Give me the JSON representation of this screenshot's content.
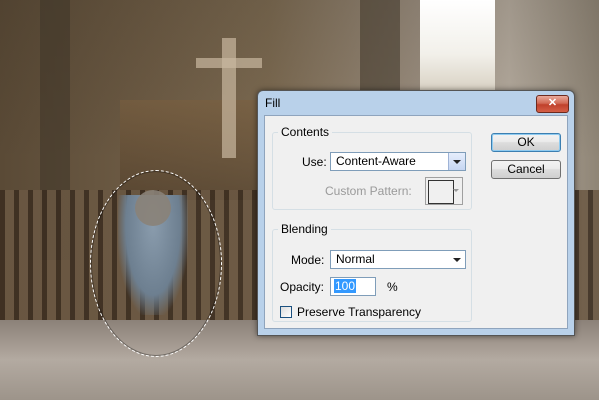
{
  "dialog": {
    "title": "Fill",
    "close_glyph": "✕",
    "contents": {
      "legend": "Contents",
      "use_label": "Use:",
      "use_value": "Content-Aware",
      "custom_pattern_label": "Custom Pattern:"
    },
    "blending": {
      "legend": "Blending",
      "mode_label": "Mode:",
      "mode_value": "Normal",
      "opacity_label": "Opacity:",
      "opacity_value": "100",
      "opacity_unit": "%",
      "preserve_label": "Preserve Transparency",
      "preserve_checked": false
    },
    "buttons": {
      "ok": "OK",
      "cancel": "Cancel"
    }
  },
  "icons": {
    "close": "close-icon",
    "dropdown": "chevron-down-icon"
  },
  "colors": {
    "title_bar": "#b9d1ea",
    "client": "#f0f0f0",
    "selection_highlight": "#3399ff",
    "close_button": "#c0412b"
  }
}
